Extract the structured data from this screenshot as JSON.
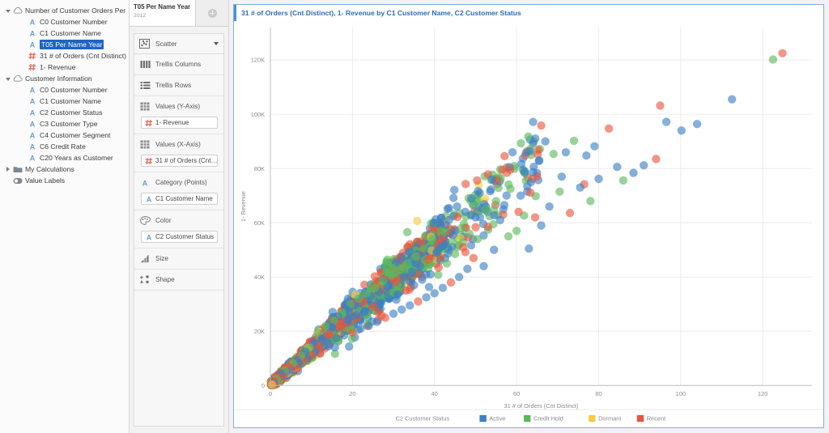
{
  "sidebar": {
    "items": [
      {
        "label": "Number of Customer Orders Per",
        "icon": "cloud-icon",
        "depth": 0,
        "twisty": "down",
        "selected": false
      },
      {
        "label": "C0 Customer Number",
        "icon": "attribute-icon",
        "depth": 1,
        "twisty": "none",
        "selected": false
      },
      {
        "label": "C1 Customer Name",
        "icon": "attribute-icon",
        "depth": 1,
        "twisty": "none",
        "selected": false
      },
      {
        "label": "T05 Per Name Year",
        "icon": "attribute-icon",
        "depth": 1,
        "twisty": "none",
        "selected": true
      },
      {
        "label": "31 # of Orders (Cnt Distinct)",
        "icon": "measure-icon",
        "depth": 1,
        "twisty": "none",
        "selected": false
      },
      {
        "label": "1- Revenue",
        "icon": "measure-icon",
        "depth": 1,
        "twisty": "none",
        "selected": false
      },
      {
        "label": "Customer Information",
        "icon": "cloud-icon",
        "depth": 0,
        "twisty": "down",
        "selected": false
      },
      {
        "label": "C0 Customer Number",
        "icon": "attribute-icon",
        "depth": 1,
        "twisty": "none",
        "selected": false
      },
      {
        "label": "C1 Customer Name",
        "icon": "attribute-icon",
        "depth": 1,
        "twisty": "none",
        "selected": false
      },
      {
        "label": "C2 Customer Status",
        "icon": "attribute-icon",
        "depth": 1,
        "twisty": "none",
        "selected": false
      },
      {
        "label": "C3 Customer Type",
        "icon": "attribute-icon",
        "depth": 1,
        "twisty": "none",
        "selected": false
      },
      {
        "label": "C4 Customer Segment",
        "icon": "attribute-icon",
        "depth": 1,
        "twisty": "none",
        "selected": false
      },
      {
        "label": "C6 Credit Rate",
        "icon": "attribute-icon",
        "depth": 1,
        "twisty": "none",
        "selected": false
      },
      {
        "label": "C20 Years as Customer",
        "icon": "attribute-icon",
        "depth": 1,
        "twisty": "none",
        "selected": false
      },
      {
        "label": "My Calculations",
        "icon": "folder-icon",
        "depth": 0,
        "twisty": "right",
        "selected": false
      },
      {
        "label": "Value Labels",
        "icon": "toggle-icon",
        "depth": 0,
        "twisty": "none",
        "selected": false
      }
    ]
  },
  "tab": {
    "title": "T05 Per Name Year",
    "subtitle": "2012",
    "add_label": "+"
  },
  "shelf": {
    "vis_type": "Scatter",
    "vis_type_icon": "scatter-icon",
    "sections": [
      {
        "name": "trellis-columns",
        "label": "Trellis Columns",
        "icon": "trellis-columns-icon",
        "pill": null
      },
      {
        "name": "trellis-rows",
        "label": "Trellis Rows",
        "icon": "trellis-rows-icon",
        "pill": null
      },
      {
        "name": "values-y",
        "label": "Values (Y-Axis)",
        "icon": "grid-icon",
        "pill": {
          "label": "1- Revenue",
          "icon": "measure-icon"
        }
      },
      {
        "name": "values-x",
        "label": "Values (X-Axis)",
        "icon": "grid-icon",
        "pill": {
          "label": "31 # of Orders (Cnt…",
          "icon": "measure-icon"
        }
      },
      {
        "name": "category",
        "label": "Category (Points)",
        "icon": "attribute-icon",
        "pill": {
          "label": "C1 Customer Name",
          "icon": "attribute-icon"
        }
      },
      {
        "name": "color",
        "label": "Color",
        "icon": "palette-icon",
        "pill": {
          "label": "C2 Customer Status",
          "icon": "attribute-icon"
        }
      },
      {
        "name": "size",
        "label": "Size",
        "icon": "size-icon",
        "pill": null
      },
      {
        "name": "shape",
        "label": "Shape",
        "icon": "shape-icon",
        "pill": null
      }
    ]
  },
  "chart_data": {
    "type": "scatter",
    "title": "31 # of Orders (Cnt Distinct), 1- Revenue by C1 Customer Name, C2 Customer Status",
    "xlabel": "31 # of Orders (Cnt Distinct)",
    "ylabel": "1- Revenue",
    "xlim": [
      0,
      132
    ],
    "ylim": [
      0,
      132000
    ],
    "xticks": [
      0,
      20,
      40,
      60,
      80,
      100,
      120
    ],
    "xticklabels": [
      "0",
      "20",
      "40",
      "60",
      "80",
      "100",
      "120"
    ],
    "yticks": [
      0,
      20000,
      40000,
      60000,
      80000,
      100000,
      120000
    ],
    "yticklabels": [
      "0",
      "20K",
      "40K",
      "60K",
      "80K",
      "100K",
      "120K"
    ],
    "grid": true,
    "legend_position": "bottom",
    "legend_title": "C2 Customer Status",
    "marker_radius": 5.2,
    "marker_opacity": 0.62,
    "series": [
      {
        "name": "Active",
        "color": "#3a7fc4"
      },
      {
        "name": "Credit Hold",
        "color": "#5cb85c"
      },
      {
        "name": "Dormant",
        "color": "#f5cb42"
      },
      {
        "name": "Recent",
        "color": "#e8553c"
      }
    ],
    "points": [
      {
        "x": 124.8,
        "y": 122500,
        "s": 3
      },
      {
        "x": 122.5,
        "y": 120200,
        "s": 1
      },
      {
        "x": 112.5,
        "y": 105500,
        "s": 0
      },
      {
        "x": 104.0,
        "y": 96400,
        "s": 0
      },
      {
        "x": 100.2,
        "y": 94000,
        "s": 0
      },
      {
        "x": 95.0,
        "y": 103200,
        "s": 3
      },
      {
        "x": 96.5,
        "y": 97200,
        "s": 0
      },
      {
        "x": 94.0,
        "y": 83500,
        "s": 3
      },
      {
        "x": 91.0,
        "y": 81200,
        "s": 0
      },
      {
        "x": 88.5,
        "y": 78400,
        "s": 0
      },
      {
        "x": 86.0,
        "y": 75600,
        "s": 1
      },
      {
        "x": 84.5,
        "y": 80600,
        "s": 0
      },
      {
        "x": 82.5,
        "y": 94700,
        "s": 3
      },
      {
        "x": 80.0,
        "y": 76200,
        "s": 0
      },
      {
        "x": 79.0,
        "y": 88200,
        "s": 0
      },
      {
        "x": 78.0,
        "y": 68000,
        "s": 1
      },
      {
        "x": 77.0,
        "y": 84800,
        "s": 0
      },
      {
        "x": 76.5,
        "y": 74200,
        "s": 3
      },
      {
        "x": 75.5,
        "y": 73000,
        "s": 0
      },
      {
        "x": 74.0,
        "y": 90200,
        "s": 1
      },
      {
        "x": 73.0,
        "y": 63600,
        "s": 3
      },
      {
        "x": 72.0,
        "y": 86000,
        "s": 0
      },
      {
        "x": 71.0,
        "y": 77000,
        "s": 0
      },
      {
        "x": 70.5,
        "y": 71500,
        "s": 1
      },
      {
        "x": 69.0,
        "y": 85400,
        "s": 1
      },
      {
        "x": 68.0,
        "y": 66000,
        "s": 0
      },
      {
        "x": 67.0,
        "y": 90000,
        "s": 0
      },
      {
        "x": 66.0,
        "y": 59000,
        "s": 0
      },
      {
        "x": 65.5,
        "y": 83000,
        "s": 0
      },
      {
        "x": 64.5,
        "y": 62000,
        "s": 3
      },
      {
        "x": 63.5,
        "y": 75000,
        "s": 0
      },
      {
        "x": 63.0,
        "y": 50500,
        "s": 0
      },
      {
        "x": 62.0,
        "y": 79000,
        "s": 0
      },
      {
        "x": 61.0,
        "y": 70000,
        "s": 0
      },
      {
        "x": 60.5,
        "y": 64000,
        "s": 3
      },
      {
        "x": 60.0,
        "y": 57000,
        "s": 1
      },
      {
        "x": 59.0,
        "y": 86000,
        "s": 0
      },
      {
        "x": 58.5,
        "y": 72500,
        "s": 1
      },
      {
        "x": 58.0,
        "y": 55000,
        "s": 1
      },
      {
        "x": 57.0,
        "y": 66500,
        "s": 0
      },
      {
        "x": 56.5,
        "y": 79500,
        "s": 3
      },
      {
        "x": 56.0,
        "y": 61000,
        "s": 0
      },
      {
        "x": 55.0,
        "y": 68000,
        "s": 1
      },
      {
        "x": 54.5,
        "y": 50000,
        "s": 0
      },
      {
        "x": 54.0,
        "y": 76000,
        "s": 0
      },
      {
        "x": 53.0,
        "y": 58500,
        "s": 3
      },
      {
        "x": 52.5,
        "y": 65000,
        "s": 1
      },
      {
        "x": 52.0,
        "y": 44000,
        "s": 0
      },
      {
        "x": 51.0,
        "y": 71000,
        "s": 0
      },
      {
        "x": 50.5,
        "y": 54000,
        "s": 1
      },
      {
        "x": 50.0,
        "y": 62000,
        "s": 0
      },
      {
        "x": 49.5,
        "y": 47000,
        "s": 3
      },
      {
        "x": 49.0,
        "y": 69000,
        "s": 0
      },
      {
        "x": 48.5,
        "y": 56000,
        "s": 1
      },
      {
        "x": 48.0,
        "y": 43000,
        "s": 0
      },
      {
        "x": 47.5,
        "y": 64000,
        "s": 0
      },
      {
        "x": 47.0,
        "y": 51000,
        "s": 3
      },
      {
        "x": 46.5,
        "y": 58000,
        "s": 1
      },
      {
        "x": 46.0,
        "y": 40000,
        "s": 0
      },
      {
        "x": 45.5,
        "y": 66000,
        "s": 0
      },
      {
        "x": 45.0,
        "y": 48500,
        "s": 1
      },
      {
        "x": 44.5,
        "y": 55500,
        "s": 0
      },
      {
        "x": 44.0,
        "y": 38000,
        "s": 3
      },
      {
        "x": 43.5,
        "y": 61000,
        "s": 0
      },
      {
        "x": 43.0,
        "y": 45000,
        "s": 1
      },
      {
        "x": 42.5,
        "y": 52000,
        "s": 0
      },
      {
        "x": 42.0,
        "y": 36000,
        "s": 0
      },
      {
        "x": 41.5,
        "y": 57000,
        "s": 1
      },
      {
        "x": 41.0,
        "y": 43500,
        "s": 3
      },
      {
        "x": 40.5,
        "y": 49000,
        "s": 0
      },
      {
        "x": 40.0,
        "y": 34000,
        "s": 0
      },
      {
        "x": 39.5,
        "y": 54000,
        "s": 1
      },
      {
        "x": 39.0,
        "y": 41000,
        "s": 0
      },
      {
        "x": 38.5,
        "y": 46500,
        "s": 3
      },
      {
        "x": 38.0,
        "y": 32500,
        "s": 0
      },
      {
        "x": 37.5,
        "y": 50500,
        "s": 1
      },
      {
        "x": 37.0,
        "y": 39000,
        "s": 0
      },
      {
        "x": 36.5,
        "y": 44000,
        "s": 0
      },
      {
        "x": 36.0,
        "y": 31000,
        "s": 3
      },
      {
        "x": 35.5,
        "y": 47500,
        "s": 1
      },
      {
        "x": 35.0,
        "y": 37000,
        "s": 0
      },
      {
        "x": 34.5,
        "y": 42000,
        "s": 0
      },
      {
        "x": 34.0,
        "y": 29500,
        "s": 0
      },
      {
        "x": 33.5,
        "y": 45000,
        "s": 1
      },
      {
        "x": 33.0,
        "y": 35000,
        "s": 3
      },
      {
        "x": 32.5,
        "y": 40000,
        "s": 0
      },
      {
        "x": 32.0,
        "y": 28000,
        "s": 0
      },
      {
        "x": 31.5,
        "y": 42500,
        "s": 1
      },
      {
        "x": 31.0,
        "y": 33500,
        "s": 0
      },
      {
        "x": 30.5,
        "y": 38000,
        "s": 3
      },
      {
        "x": 30.0,
        "y": 26500,
        "s": 0
      },
      {
        "x": 29.5,
        "y": 40500,
        "s": 1
      },
      {
        "x": 29.0,
        "y": 32000,
        "s": 0
      },
      {
        "x": 28.5,
        "y": 36500,
        "s": 0
      },
      {
        "x": 28.0,
        "y": 25000,
        "s": 3
      },
      {
        "x": 27.5,
        "y": 38500,
        "s": 1
      },
      {
        "x": 27.0,
        "y": 30500,
        "s": 0
      },
      {
        "x": 26.5,
        "y": 34500,
        "s": 0
      },
      {
        "x": 26.0,
        "y": 23500,
        "s": 0
      },
      {
        "x": 25.5,
        "y": 36000,
        "s": 1
      },
      {
        "x": 25.0,
        "y": 29000,
        "s": 3
      },
      {
        "x": 24.5,
        "y": 33000,
        "s": 0
      },
      {
        "x": 24.0,
        "y": 22000,
        "s": 0
      },
      {
        "x": 23.5,
        "y": 34000,
        "s": 1
      },
      {
        "x": 23.0,
        "y": 27500,
        "s": 0
      },
      {
        "x": 22.5,
        "y": 31000,
        "s": 3
      },
      {
        "x": 22.0,
        "y": 21000,
        "s": 0
      },
      {
        "x": 21.5,
        "y": 32000,
        "s": 1
      },
      {
        "x": 21.0,
        "y": 26000,
        "s": 0
      },
      {
        "x": 20.5,
        "y": 29500,
        "s": 0
      },
      {
        "x": 20.0,
        "y": 19500,
        "s": 3
      },
      {
        "x": 19.5,
        "y": 30000,
        "s": 1
      },
      {
        "x": 19.0,
        "y": 24500,
        "s": 0
      },
      {
        "x": 18.5,
        "y": 28000,
        "s": 0
      },
      {
        "x": 18.0,
        "y": 18500,
        "s": 0
      },
      {
        "x": 17.5,
        "y": 27000,
        "s": 1
      },
      {
        "x": 17.0,
        "y": 23000,
        "s": 3
      },
      {
        "x": 16.5,
        "y": 25500,
        "s": 0
      },
      {
        "x": 16.0,
        "y": 17500,
        "s": 0
      },
      {
        "x": 15.5,
        "y": 24000,
        "s": 1
      },
      {
        "x": 15.0,
        "y": 21500,
        "s": 0
      },
      {
        "x": 14.5,
        "y": 19000,
        "s": 3
      },
      {
        "x": 14.0,
        "y": 16000,
        "s": 0
      },
      {
        "x": 13.5,
        "y": 22000,
        "s": 1
      },
      {
        "x": 13.0,
        "y": 14500,
        "s": 0
      },
      {
        "x": 12.5,
        "y": 17000,
        "s": 0
      },
      {
        "x": 12.0,
        "y": 13500,
        "s": 3
      },
      {
        "x": 11.5,
        "y": 19500,
        "s": 1
      },
      {
        "x": 11.0,
        "y": 12500,
        "s": 0
      },
      {
        "x": 10.5,
        "y": 15500,
        "s": 0
      },
      {
        "x": 10.0,
        "y": 11000,
        "s": 3
      },
      {
        "x": 9.5,
        "y": 14000,
        "s": 1
      },
      {
        "x": 9.0,
        "y": 10000,
        "s": 0
      },
      {
        "x": 8.5,
        "y": 12500,
        "s": 0
      },
      {
        "x": 8.0,
        "y": 9000,
        "s": 3
      },
      {
        "x": 7.5,
        "y": 11000,
        "s": 1
      },
      {
        "x": 7.0,
        "y": 8000,
        "s": 0
      },
      {
        "x": 6.5,
        "y": 9500,
        "s": 0
      },
      {
        "x": 6.0,
        "y": 7000,
        "s": 3
      },
      {
        "x": 5.5,
        "y": 8200,
        "s": 1
      },
      {
        "x": 5.0,
        "y": 6000,
        "s": 0
      },
      {
        "x": 4.5,
        "y": 6800,
        "s": 3
      },
      {
        "x": 4.0,
        "y": 5000,
        "s": 0
      },
      {
        "x": 3.5,
        "y": 5600,
        "s": 1
      },
      {
        "x": 3.0,
        "y": 4000,
        "s": 3
      },
      {
        "x": 2.5,
        "y": 4400,
        "s": 0
      },
      {
        "x": 2.0,
        "y": 3000,
        "s": 3
      },
      {
        "x": 1.5,
        "y": 2400,
        "s": 1
      },
      {
        "x": 1.0,
        "y": 1500,
        "s": 3
      },
      {
        "x": 0.8,
        "y": 900,
        "s": 0
      },
      {
        "x": 0.5,
        "y": 600,
        "s": 3
      },
      {
        "x": 0.4,
        "y": 350,
        "s": 2
      }
    ],
    "cluster_note": "Dense diagonal cluster of several thousand overlapping semi-transparent points from origin up to roughly x=35, y=45000, thinning out toward the upper right."
  },
  "legend": {
    "title": "C2 Customer Status",
    "entries": [
      {
        "label": "Active",
        "color": "#3a7fc4"
      },
      {
        "label": "Credit Hold",
        "color": "#5cb85c"
      },
      {
        "label": "Dormant",
        "color": "#f5cb42"
      },
      {
        "label": "Recent",
        "color": "#e8553c"
      }
    ]
  },
  "colors": {
    "accent": "#4a90d9",
    "title_text": "#2f6cb5",
    "selection": "#1f63c4",
    "attribute_icon": "#6b9fd4",
    "measure_icon": "#e8766a"
  }
}
